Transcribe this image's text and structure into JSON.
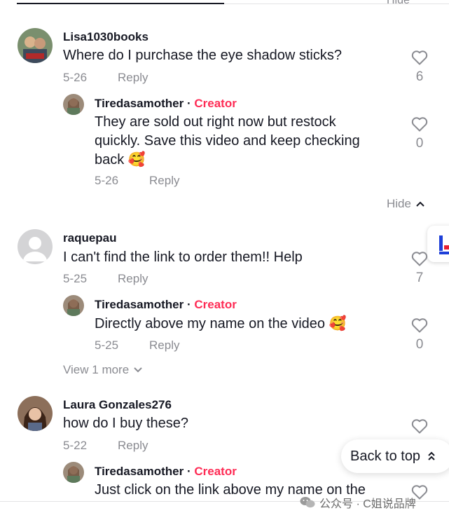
{
  "top": {
    "hide_label": "Hide"
  },
  "comments": [
    {
      "username": "Lisa1030books",
      "text": "Where do I purchase the eye shadow sticks?",
      "date": "5-26",
      "reply_label": "Reply",
      "likes": "6",
      "replies": [
        {
          "username": "Tiredasamother",
          "separator": "·",
          "badge": "Creator",
          "text": "They are sold out right now but restock quickly. Save this video and keep checking back 🥰",
          "date": "5-26",
          "reply_label": "Reply",
          "likes": "0"
        }
      ],
      "hide_label": "Hide"
    },
    {
      "username": "raquepau",
      "text": "I can't find the link to order them!! Help",
      "date": "5-25",
      "reply_label": "Reply",
      "likes": "7",
      "replies": [
        {
          "username": "Tiredasamother",
          "separator": "·",
          "badge": "Creator",
          "text": "Directly above my name on the video 🥰",
          "date": "5-25",
          "reply_label": "Reply",
          "likes": "0"
        }
      ],
      "view_more_label": "View 1 more"
    },
    {
      "username": "Laura Gonzales276",
      "text": "how do I buy these?",
      "date": "5-22",
      "reply_label": "Reply",
      "replies": [
        {
          "username": "Tiredasamother",
          "separator": "·",
          "badge": "Creator",
          "text": "Just click on the link above my name on the"
        }
      ]
    }
  ],
  "back_to_top": {
    "label": "Back to top"
  },
  "watermark": {
    "text": "公众号 · C姐说品牌"
  },
  "colors": {
    "creator": "#fe2c55",
    "muted": "#8a8b91",
    "text": "#161823"
  }
}
